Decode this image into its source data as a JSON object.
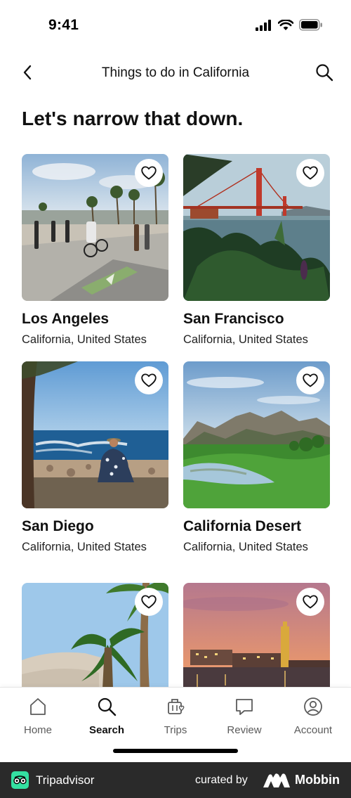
{
  "status_bar": {
    "time": "9:41"
  },
  "header": {
    "title": "Things to do in California"
  },
  "heading": "Let's narrow that down.",
  "destinations": [
    {
      "name": "Los Angeles",
      "region": "California, United States"
    },
    {
      "name": "San Francisco",
      "region": "California, United States"
    },
    {
      "name": "San Diego",
      "region": "California, United States"
    },
    {
      "name": "California Desert",
      "region": "California, United States"
    },
    {
      "name": "",
      "region": ""
    },
    {
      "name": "",
      "region": ""
    }
  ],
  "bottom_nav": [
    {
      "label": "Home",
      "icon": "home-icon",
      "active": false
    },
    {
      "label": "Search",
      "icon": "search-icon",
      "active": true
    },
    {
      "label": "Trips",
      "icon": "trips-icon",
      "active": false
    },
    {
      "label": "Review",
      "icon": "review-icon",
      "active": false
    },
    {
      "label": "Account",
      "icon": "account-icon",
      "active": false
    }
  ],
  "footer": {
    "brand": "Tripadvisor",
    "curated_by": "curated by",
    "curator": "Mobbin"
  },
  "colors": {
    "accent": "#34e0a1",
    "footer_bg": "#2a2a2a",
    "text": "#111111"
  }
}
